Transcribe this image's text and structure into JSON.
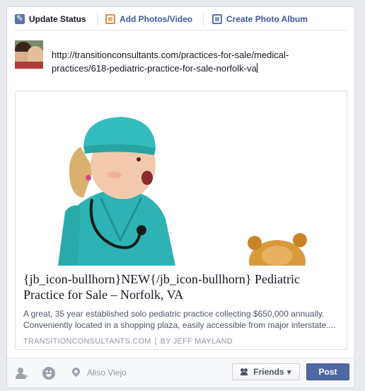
{
  "tabs": [
    {
      "label": "Update Status",
      "icon": "pencil-icon",
      "active": true
    },
    {
      "label": "Add Photos/Video",
      "icon": "photo-icon",
      "active": false
    },
    {
      "label": "Create Photo Album",
      "icon": "album-icon",
      "active": false
    }
  ],
  "status_input": {
    "value": "http://transitionconsultants.com/practices-for-sale/medical-practices/618-pediatric-practice-for-sale-norfolk-va"
  },
  "link_preview": {
    "title": "{jb_icon-bullhorn}NEW{/jb_icon-bullhorn} Pediatric Practice for Sale – Norfolk, VA",
    "description": "A great, 35 year established solo pediatric practice collecting $650,000 annually. Conveniently located in a shopping plaza, easily accessible from major interstate....",
    "domain": "TRANSITIONCONSULTANTS.COM",
    "separator": "|",
    "author": "BY JEFF MAYLAND"
  },
  "footer": {
    "location": "Aliso Viejo",
    "audience_label": "Friends",
    "post_label": "Post"
  },
  "colors": {
    "accent": "#3b5998",
    "post_button": "#4e69a2",
    "scrubs": "#2db3b3"
  }
}
